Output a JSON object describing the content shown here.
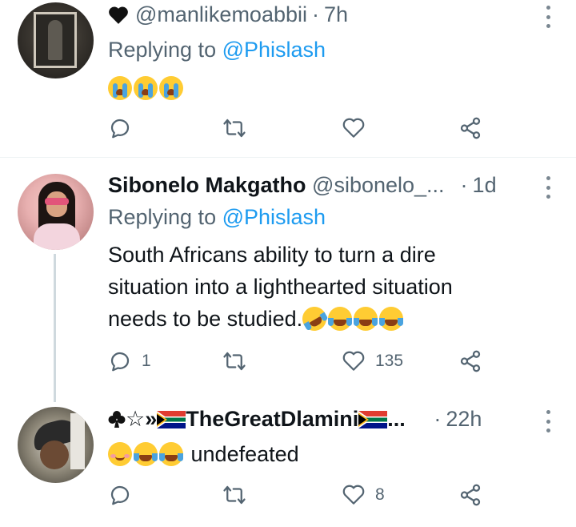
{
  "tweets": [
    {
      "display_name": "",
      "handle": "@manlikemoabbii",
      "time": "7h",
      "replying_prefix": "Replying to",
      "replying_handle": "@Phislash",
      "text": "",
      "emojis": [
        "loudly-crying-face",
        "loudly-crying-face",
        "loudly-crying-face"
      ],
      "counts": {
        "reply": "",
        "retweet": "",
        "like": ""
      }
    },
    {
      "display_name": "Sibonelo Makgatho",
      "handle": "@sibonelo_...",
      "time": "1d",
      "replying_prefix": "Replying to",
      "replying_handle": "@Phislash",
      "text_lines": [
        "South Africans ability to turn a dire",
        "situation into a lighthearted situation",
        "needs to be studied."
      ],
      "emojis": [
        "rolling-on-floor-laughing",
        "face-with-tears-of-joy",
        "face-with-tears-of-joy",
        "face-with-tears-of-joy"
      ],
      "counts": {
        "reply": "1",
        "retweet": "",
        "like": "135"
      }
    },
    {
      "display_name": "TheGreatDlamini",
      "name_prefix": "☆»",
      "name_suffix": "...",
      "handle": "",
      "time": "22h",
      "text": "undefeated",
      "emojis": [
        "smiling-face-with-smiling-eyes",
        "face-with-tears-of-joy",
        "face-with-tears-of-joy"
      ],
      "counts": {
        "reply": "",
        "retweet": "",
        "like": "8"
      }
    }
  ],
  "separator_dot": "·",
  "colors": {
    "text": "#0f1419",
    "secondary": "#536471",
    "link": "#1d9bf0",
    "divider": "#eff3f4"
  }
}
